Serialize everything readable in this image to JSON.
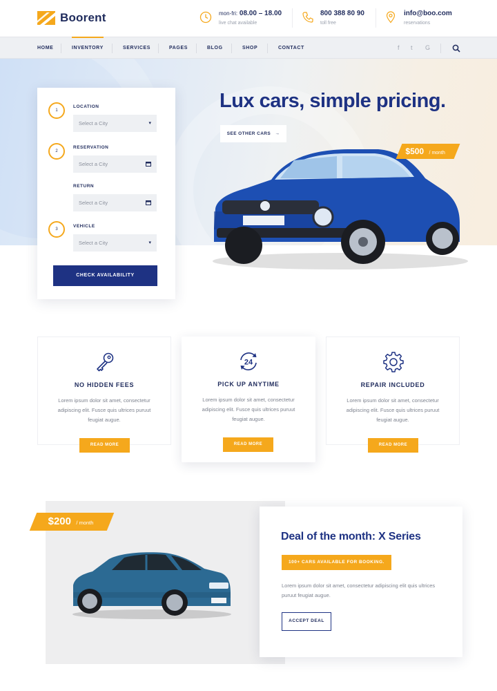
{
  "brand": {
    "name": "Boorent",
    "accent": "#f5a81c",
    "primary": "#1e3283"
  },
  "header": {
    "hours": {
      "label": "mon-fri:",
      "value": "08.00 – 18.00",
      "sub": "live chat available",
      "icon": "clock-icon"
    },
    "phone": {
      "value": "800 388 80 90",
      "sub": "toll free",
      "icon": "phone-icon"
    },
    "email": {
      "value": "info@boo.com",
      "sub": "reservations",
      "icon": "location-pin-icon"
    }
  },
  "nav": {
    "items": [
      "HOME",
      "INVENTORY",
      "SERVICES",
      "PAGES",
      "BLOG",
      "SHOP",
      "CONTACT"
    ],
    "active": "INVENTORY",
    "social": [
      "f",
      "t",
      "G"
    ]
  },
  "hero": {
    "title": "Lux cars, simple pricing.",
    "cta": "SEE OTHER CARS",
    "price": "$500",
    "per": "/ month"
  },
  "booking": {
    "steps": [
      "1",
      "2",
      "3"
    ],
    "location_label": "LOCATION",
    "location_placeholder": "Select a City",
    "reservation_label": "RESERVATION",
    "reservation_placeholder": "Select a City",
    "return_label": "RETURN",
    "return_placeholder": "Select a City",
    "vehicle_label": "VEHICLE",
    "vehicle_placeholder": "Select a City",
    "submit": "CHECK AVAILABILITY"
  },
  "features": [
    {
      "title": "NO HIDDEN FEES",
      "text": "Lorem ipsum dolor sit amet, consectetur adipiscing elit. Fusce quis ultrices puruut feugiat augue.",
      "button": "READ MORE",
      "icon": "key-icon"
    },
    {
      "title": "PICK UP ANYTIME",
      "text": "Lorem ipsum dolor sit amet, consectetur adipiscing elit. Fusce quis ultrices puruut feugiat augue.",
      "button": "READ MORE",
      "icon": "24-hours-icon"
    },
    {
      "title": "REPAIR INCLUDED",
      "text": "Lorem ipsum dolor sit amet, consectetur adipiscing elit. Fusce quis ultrices puruut feugiat augue.",
      "button": "READ MORE",
      "icon": "gear-icon"
    }
  ],
  "deal": {
    "price": "$200",
    "per": "/ month",
    "title": "Deal of the month: X Series",
    "badge": "100+ CARS AVAILABLE FOR BOOKING.",
    "text": "Lorem ipsum dolor sit amet, consectetur adipiscing elit quis ultrices puruut feugiat augue.",
    "button": "ACCEPT DEAL"
  }
}
